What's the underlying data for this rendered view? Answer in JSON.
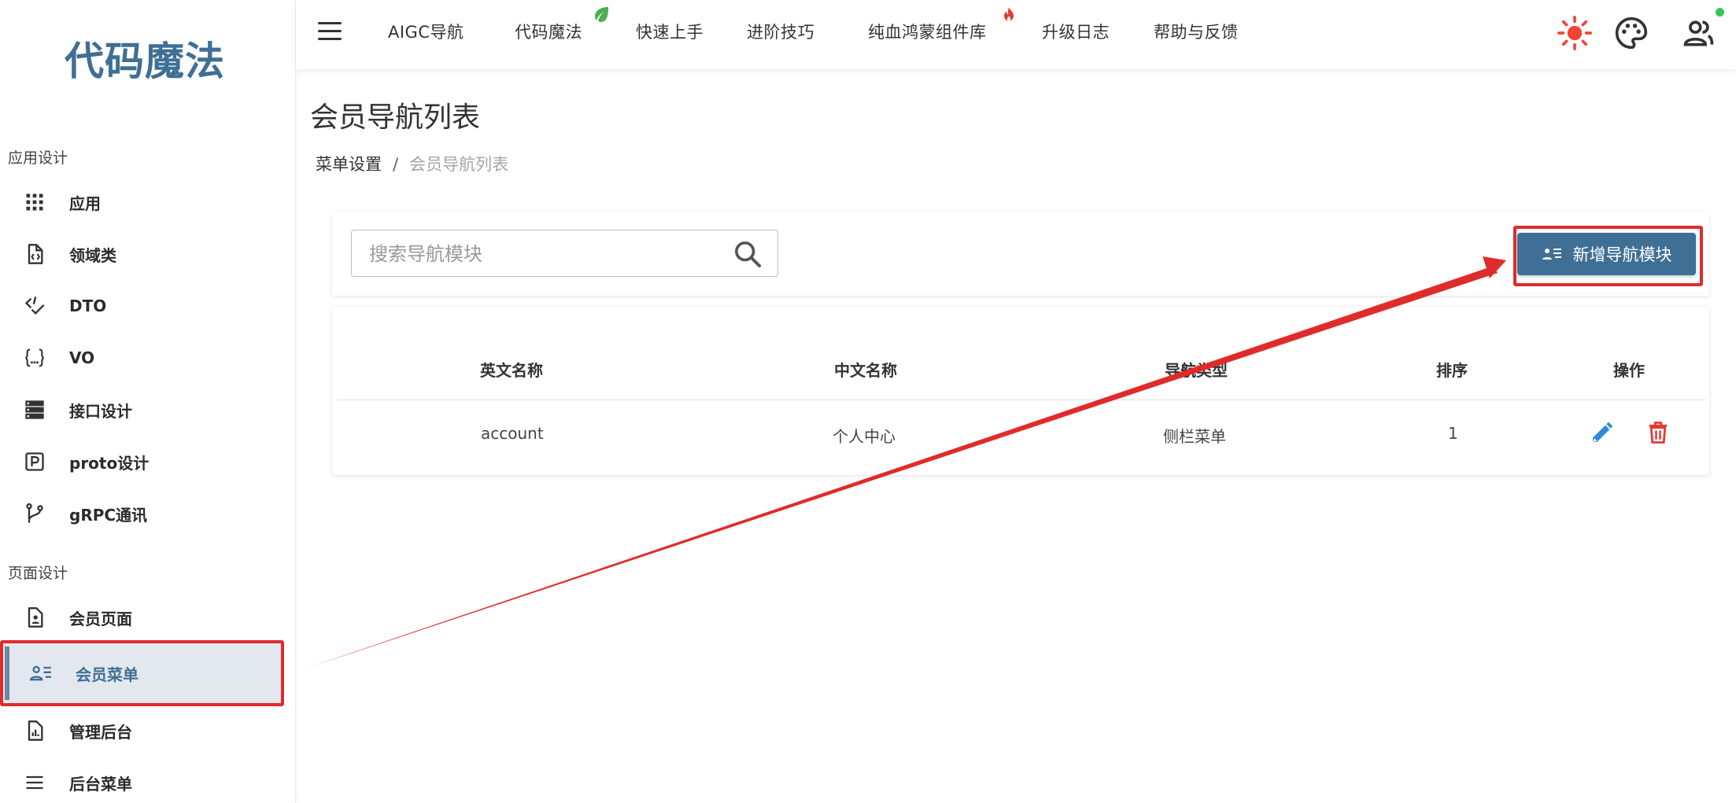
{
  "sidebar": {
    "logo": "代码魔法",
    "sections": [
      {
        "title": "应用设计"
      },
      {
        "title": "页面设计"
      }
    ],
    "items": [
      {
        "label": "应用",
        "icon": "grid-icon"
      },
      {
        "label": "领域类",
        "icon": "code-file-icon"
      },
      {
        "label": "DTO",
        "icon": "code-check-icon"
      },
      {
        "label": "VO",
        "icon": "braces-icon"
      },
      {
        "label": "接口设计",
        "icon": "server-icon"
      },
      {
        "label": "proto设计",
        "icon": "p-square-icon"
      },
      {
        "label": "gRPC通讯",
        "icon": "source-branch-icon"
      },
      {
        "label": "会员页面",
        "icon": "account-file-icon"
      },
      {
        "label": "会员菜单",
        "icon": "account-details-icon",
        "active": true
      },
      {
        "label": "管理后台",
        "icon": "chart-file-icon"
      },
      {
        "label": "后台菜单",
        "icon": "menu-icon"
      }
    ]
  },
  "topbar": {
    "nav": [
      {
        "label": "AIGC导航"
      },
      {
        "label": "代码魔法",
        "badge": "leaf-icon"
      },
      {
        "label": "快速上手"
      },
      {
        "label": "进阶技巧"
      },
      {
        "label": "纯血鸿蒙组件库",
        "badge": "fire-icon"
      },
      {
        "label": "升级日志"
      },
      {
        "label": "帮助与反馈"
      }
    ],
    "icons": [
      "sun-icon",
      "palette-icon",
      "account-group-icon"
    ]
  },
  "page": {
    "title": "会员导航列表",
    "breadcrumb": {
      "parent": "菜单设置",
      "separator": "/",
      "current": "会员导航列表"
    }
  },
  "toolbar": {
    "search_placeholder": "搜索导航模块",
    "add_button_label": "新增导航模块"
  },
  "table": {
    "headers": [
      "英文名称",
      "中文名称",
      "导航类型",
      "排序",
      "操作"
    ],
    "rows": [
      {
        "en_name": "account",
        "cn_name": "个人中心",
        "nav_type": "侧栏菜单",
        "order": "1"
      }
    ]
  },
  "colors": {
    "primary": "#3f6f95",
    "annotation": "#e02b2b",
    "edit": "#2f8bd8",
    "delete": "#e53935",
    "sun": "#f44336"
  }
}
